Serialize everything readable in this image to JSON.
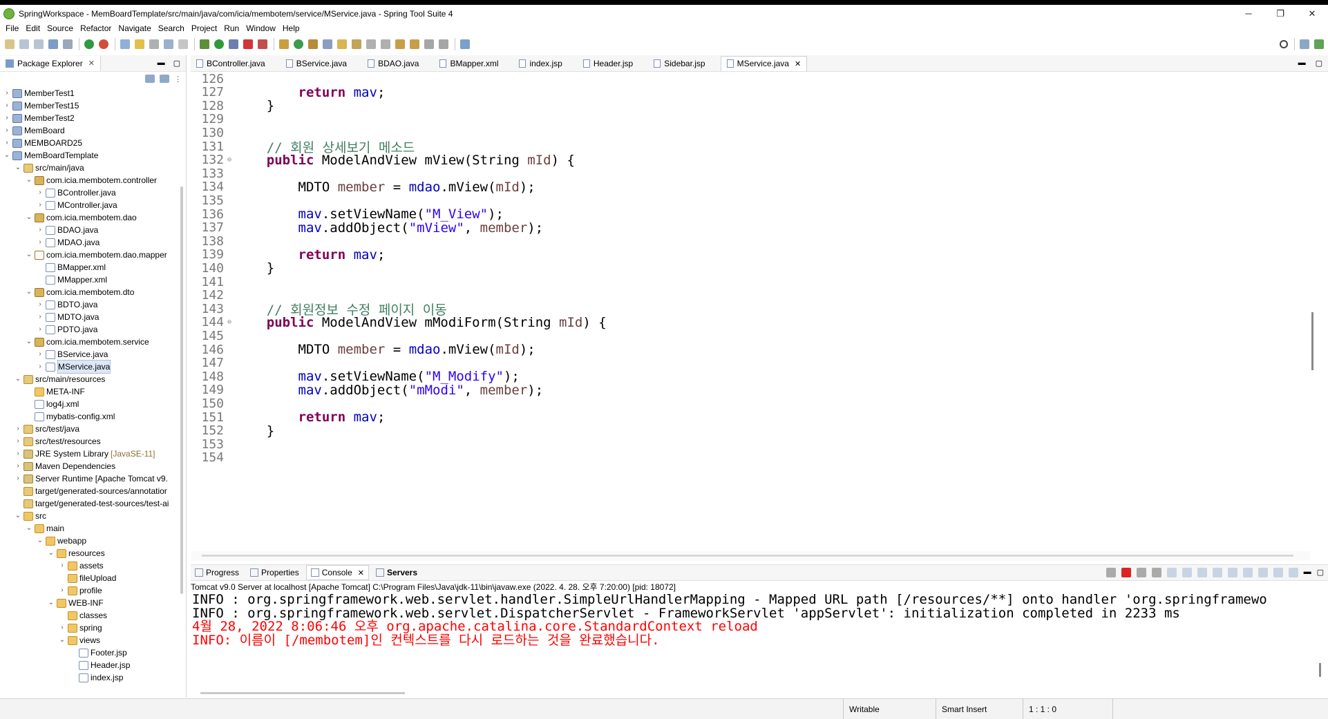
{
  "window": {
    "title": "SpringWorkspace - MemBoardTemplate/src/main/java/com/icia/membotem/service/MService.java - Spring Tool Suite 4",
    "minimize": "─",
    "maximize": "❐",
    "close": "✕"
  },
  "menu": [
    "File",
    "Edit",
    "Source",
    "Refactor",
    "Navigate",
    "Search",
    "Project",
    "Run",
    "Window",
    "Help"
  ],
  "package_explorer": {
    "tab_label": "Package Explorer",
    "tree": [
      {
        "label": "MemberTest1",
        "depth": 0,
        "expand": "right",
        "icon": "project"
      },
      {
        "label": "MemberTest15",
        "depth": 0,
        "expand": "right",
        "icon": "project"
      },
      {
        "label": "MemberTest2",
        "depth": 0,
        "expand": "right",
        "icon": "project"
      },
      {
        "label": "MemBoard",
        "depth": 0,
        "expand": "right",
        "icon": "project"
      },
      {
        "label": "MEMBOARD25",
        "depth": 0,
        "expand": "right",
        "icon": "project"
      },
      {
        "label": "MemBoardTemplate",
        "depth": 0,
        "expand": "down",
        "icon": "project"
      },
      {
        "label": "src/main/java",
        "depth": 1,
        "expand": "down",
        "icon": "srcfolder"
      },
      {
        "label": "com.icia.membotem.controller",
        "depth": 2,
        "expand": "down",
        "icon": "package"
      },
      {
        "label": "BController.java",
        "depth": 3,
        "expand": "right",
        "icon": "java"
      },
      {
        "label": "MController.java",
        "depth": 3,
        "expand": "right",
        "icon": "java"
      },
      {
        "label": "com.icia.membotem.dao",
        "depth": 2,
        "expand": "down",
        "icon": "package"
      },
      {
        "label": "BDAO.java",
        "depth": 3,
        "expand": "right",
        "icon": "java"
      },
      {
        "label": "MDAO.java",
        "depth": 3,
        "expand": "right",
        "icon": "java"
      },
      {
        "label": "com.icia.membotem.dao.mapper",
        "depth": 2,
        "expand": "down",
        "icon": "pkg-empty"
      },
      {
        "label": "BMapper.xml",
        "depth": 3,
        "expand": "",
        "icon": "xml"
      },
      {
        "label": "MMapper.xml",
        "depth": 3,
        "expand": "",
        "icon": "xml"
      },
      {
        "label": "com.icia.membotem.dto",
        "depth": 2,
        "expand": "down",
        "icon": "package"
      },
      {
        "label": "BDTO.java",
        "depth": 3,
        "expand": "right",
        "icon": "java"
      },
      {
        "label": "MDTO.java",
        "depth": 3,
        "expand": "right",
        "icon": "java"
      },
      {
        "label": "PDTO.java",
        "depth": 3,
        "expand": "right",
        "icon": "java"
      },
      {
        "label": "com.icia.membotem.service",
        "depth": 2,
        "expand": "down",
        "icon": "package"
      },
      {
        "label": "BService.java",
        "depth": 3,
        "expand": "right",
        "icon": "java"
      },
      {
        "label": "MService.java",
        "depth": 3,
        "expand": "right",
        "icon": "java",
        "selected": true
      },
      {
        "label": "src/main/resources",
        "depth": 1,
        "expand": "down",
        "icon": "srcfolder"
      },
      {
        "label": "META-INF",
        "depth": 2,
        "expand": "",
        "icon": "folder"
      },
      {
        "label": "log4j.xml",
        "depth": 2,
        "expand": "",
        "icon": "xml"
      },
      {
        "label": "mybatis-config.xml",
        "depth": 2,
        "expand": "",
        "icon": "xml"
      },
      {
        "label": "src/test/java",
        "depth": 1,
        "expand": "right",
        "icon": "srcfolder"
      },
      {
        "label": "src/test/resources",
        "depth": 1,
        "expand": "right",
        "icon": "srcfolder"
      },
      {
        "label": "JRE System Library",
        "deco": "[JavaSE-11]",
        "depth": 1,
        "expand": "right",
        "icon": "lib"
      },
      {
        "label": "Maven Dependencies",
        "depth": 1,
        "expand": "right",
        "icon": "lib"
      },
      {
        "label": "Server Runtime [Apache Tomcat v9.",
        "depth": 1,
        "expand": "right",
        "icon": "lib"
      },
      {
        "label": "target/generated-sources/annotatior",
        "depth": 1,
        "expand": "",
        "icon": "srcfolder"
      },
      {
        "label": "target/generated-test-sources/test-ai",
        "depth": 1,
        "expand": "",
        "icon": "srcfolder"
      },
      {
        "label": "src",
        "depth": 1,
        "expand": "down",
        "icon": "folder"
      },
      {
        "label": "main",
        "depth": 2,
        "expand": "down",
        "icon": "folder"
      },
      {
        "label": "webapp",
        "depth": 3,
        "expand": "down",
        "icon": "folder"
      },
      {
        "label": "resources",
        "depth": 4,
        "expand": "down",
        "icon": "folder"
      },
      {
        "label": "assets",
        "depth": 5,
        "expand": "right",
        "icon": "folder"
      },
      {
        "label": "fileUpload",
        "depth": 5,
        "expand": "",
        "icon": "folder"
      },
      {
        "label": "profile",
        "depth": 5,
        "expand": "right",
        "icon": "folder"
      },
      {
        "label": "WEB-INF",
        "depth": 4,
        "expand": "down",
        "icon": "folder"
      },
      {
        "label": "classes",
        "depth": 5,
        "expand": "",
        "icon": "folder"
      },
      {
        "label": "spring",
        "depth": 5,
        "expand": "right",
        "icon": "folder"
      },
      {
        "label": "views",
        "depth": 5,
        "expand": "down",
        "icon": "folder"
      },
      {
        "label": "Footer.jsp",
        "depth": 6,
        "expand": "",
        "icon": "jsp"
      },
      {
        "label": "Header.jsp",
        "depth": 6,
        "expand": "",
        "icon": "jsp"
      },
      {
        "label": "index.jsp",
        "depth": 6,
        "expand": "",
        "icon": "jsp"
      }
    ]
  },
  "editor": {
    "tabs": [
      "BController.java",
      "BService.java",
      "BDAO.java",
      "BMapper.xml",
      "index.jsp",
      "Header.jsp",
      "Sidebar.jsp",
      "MService.java"
    ],
    "active_tab": "MService.java",
    "lines": [
      {
        "n": "126",
        "fold": false,
        "tokens": []
      },
      {
        "n": "127",
        "fold": false,
        "tokens": [
          [
            "",
            "        "
          ],
          [
            "kw",
            "return"
          ],
          [
            "",
            " "
          ],
          [
            "fld",
            "mav"
          ],
          [
            "",
            ";"
          ]
        ]
      },
      {
        "n": "128",
        "fold": false,
        "tokens": [
          [
            "",
            "    }"
          ]
        ]
      },
      {
        "n": "129",
        "fold": false,
        "tokens": []
      },
      {
        "n": "130",
        "fold": false,
        "tokens": []
      },
      {
        "n": "131",
        "fold": false,
        "tokens": [
          [
            "",
            "    "
          ],
          [
            "cmt",
            "// 회원 상세보기 메소드"
          ]
        ]
      },
      {
        "n": "132",
        "fold": true,
        "tokens": [
          [
            "",
            "    "
          ],
          [
            "kw",
            "public"
          ],
          [
            "",
            " ModelAndView mView(String "
          ],
          [
            "var",
            "mId"
          ],
          [
            "",
            ") {"
          ]
        ]
      },
      {
        "n": "133",
        "fold": false,
        "tokens": []
      },
      {
        "n": "134",
        "fold": false,
        "tokens": [
          [
            "",
            "        MDTO "
          ],
          [
            "var",
            "member"
          ],
          [
            "",
            " = "
          ],
          [
            "fld",
            "mdao"
          ],
          [
            "",
            ".mView("
          ],
          [
            "var",
            "mId"
          ],
          [
            "",
            ");"
          ]
        ]
      },
      {
        "n": "135",
        "fold": false,
        "tokens": []
      },
      {
        "n": "136",
        "fold": false,
        "tokens": [
          [
            "",
            "        "
          ],
          [
            "fld",
            "mav"
          ],
          [
            "",
            ".setViewName("
          ],
          [
            "str",
            "\"M_View\""
          ],
          [
            "",
            ");"
          ]
        ]
      },
      {
        "n": "137",
        "fold": false,
        "tokens": [
          [
            "",
            "        "
          ],
          [
            "fld",
            "mav"
          ],
          [
            "",
            ".addObject("
          ],
          [
            "str",
            "\"mView\""
          ],
          [
            "",
            ", "
          ],
          [
            "var",
            "member"
          ],
          [
            "",
            ");"
          ]
        ]
      },
      {
        "n": "138",
        "fold": false,
        "tokens": []
      },
      {
        "n": "139",
        "fold": false,
        "tokens": [
          [
            "",
            "        "
          ],
          [
            "kw",
            "return"
          ],
          [
            "",
            " "
          ],
          [
            "fld",
            "mav"
          ],
          [
            "",
            ";"
          ]
        ]
      },
      {
        "n": "140",
        "fold": false,
        "tokens": [
          [
            "",
            "    }"
          ]
        ]
      },
      {
        "n": "141",
        "fold": false,
        "tokens": []
      },
      {
        "n": "142",
        "fold": false,
        "tokens": []
      },
      {
        "n": "143",
        "fold": false,
        "tokens": [
          [
            "",
            "    "
          ],
          [
            "cmt",
            "// 회원정보 수정 페이지 이동"
          ]
        ]
      },
      {
        "n": "144",
        "fold": true,
        "tokens": [
          [
            "",
            "    "
          ],
          [
            "kw",
            "public"
          ],
          [
            "",
            " ModelAndView mModiForm(String "
          ],
          [
            "var",
            "mId"
          ],
          [
            "",
            ") {"
          ]
        ]
      },
      {
        "n": "145",
        "fold": false,
        "tokens": []
      },
      {
        "n": "146",
        "fold": false,
        "tokens": [
          [
            "",
            "        MDTO "
          ],
          [
            "var",
            "member"
          ],
          [
            "",
            " = "
          ],
          [
            "fld",
            "mdao"
          ],
          [
            "",
            ".mView("
          ],
          [
            "var",
            "mId"
          ],
          [
            "",
            ");"
          ]
        ]
      },
      {
        "n": "147",
        "fold": false,
        "tokens": []
      },
      {
        "n": "148",
        "fold": false,
        "tokens": [
          [
            "",
            "        "
          ],
          [
            "fld",
            "mav"
          ],
          [
            "",
            ".setViewName("
          ],
          [
            "str",
            "\"M_Modify\""
          ],
          [
            "",
            ");"
          ]
        ]
      },
      {
        "n": "149",
        "fold": false,
        "tokens": [
          [
            "",
            "        "
          ],
          [
            "fld",
            "mav"
          ],
          [
            "",
            ".addObject("
          ],
          [
            "str",
            "\"mModi\""
          ],
          [
            "",
            ", "
          ],
          [
            "var",
            "member"
          ],
          [
            "",
            ");"
          ]
        ]
      },
      {
        "n": "150",
        "fold": false,
        "tokens": []
      },
      {
        "n": "151",
        "fold": false,
        "tokens": [
          [
            "",
            "        "
          ],
          [
            "kw",
            "return"
          ],
          [
            "",
            " "
          ],
          [
            "fld",
            "mav"
          ],
          [
            "",
            ";"
          ]
        ]
      },
      {
        "n": "152",
        "fold": false,
        "tokens": [
          [
            "",
            "    }"
          ]
        ]
      },
      {
        "n": "153",
        "fold": false,
        "tokens": []
      },
      {
        "n": "154",
        "fold": false,
        "tokens": []
      }
    ]
  },
  "console": {
    "tabs": [
      {
        "label": "Progress",
        "active": false,
        "bold": false,
        "closable": false
      },
      {
        "label": "Properties",
        "active": false,
        "bold": false,
        "closable": false
      },
      {
        "label": "Console",
        "active": true,
        "bold": false,
        "closable": true
      },
      {
        "label": "Servers",
        "active": false,
        "bold": true,
        "closable": false
      }
    ],
    "info": "Tomcat v9.0 Server at localhost [Apache Tomcat] C:\\Program Files\\Java\\jdk-11\\bin\\javaw.exe  (2022. 4. 28. 오후 7:20:00) [pid: 18072]",
    "lines": [
      {
        "text": "INFO : org.springframework.web.servlet.handler.SimpleUrlHandlerMapping - Mapped URL path [/resources/**] onto handler 'org.springframewo",
        "error": false
      },
      {
        "text": "INFO : org.springframework.web.servlet.DispatcherServlet - FrameworkServlet 'appServlet': initialization completed in 2233 ms",
        "error": false
      },
      {
        "text": "4월 28, 2022 8:06:46 오후 org.apache.catalina.core.StandardContext reload",
        "error": true
      },
      {
        "text": "INFO: 이름이 [/membotem]인 컨텍스트를 다시 로드하는 것을 완료했습니다.",
        "error": true
      }
    ]
  },
  "status": {
    "writable": "Writable",
    "insert_mode": "Smart Insert",
    "position": "1 : 1 : 0"
  },
  "colors": {
    "keyword": "#7f0055",
    "field": "#0000c0",
    "local_var": "#6a3e3e",
    "string": "#2a00ff",
    "comment": "#3f7f5f",
    "console_error": "#ff0000"
  }
}
